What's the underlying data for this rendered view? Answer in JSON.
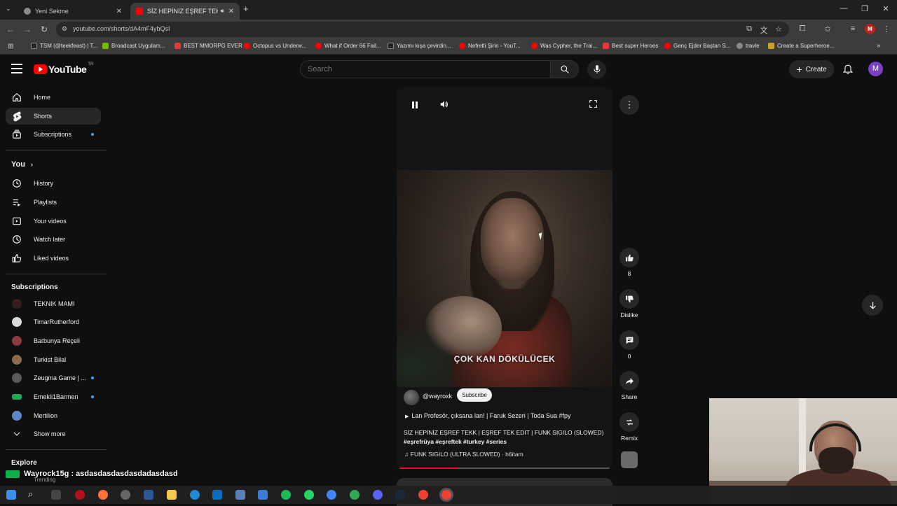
{
  "browser": {
    "tabs": [
      {
        "label": "Yeni Sekme",
        "active": false
      },
      {
        "label": "SİZ HEPİNİZ EŞREF TEKK | E",
        "active": true
      }
    ],
    "url": "youtube.com/shorts/dA4mF4ybQsI",
    "bookmarks": [
      "TSM (@teekfeast) | T...",
      "Broadcast Uygulam...",
      "BEST MMORPG EVER",
      "Octopus vs Underw...",
      "What if Order 66 Fail...",
      "Yazımı kışa çevirdin...",
      "Nefretli Şirin - YouT...",
      "Was Cypher, the Trai...",
      "Best super Heroes",
      "Genç Ejder Baştan S...",
      "travle",
      "Create a Superheroe..."
    ],
    "profile_initial": "M"
  },
  "header": {
    "logo_text": "YouTube",
    "country_code": "TR",
    "search_placeholder": "Search",
    "create_label": "Create",
    "avatar_initial": "M"
  },
  "sidebar": {
    "main": [
      {
        "label": "Home",
        "icon": "home-icon"
      },
      {
        "label": "Shorts",
        "icon": "shorts-icon",
        "active": true
      },
      {
        "label": "Subscriptions",
        "icon": "subscriptions-icon",
        "dot": true
      }
    ],
    "you_heading": "You",
    "you_items": [
      {
        "label": "History",
        "icon": "history-icon"
      },
      {
        "label": "Playlists",
        "icon": "playlists-icon"
      },
      {
        "label": "Your videos",
        "icon": "your-videos-icon"
      },
      {
        "label": "Watch later",
        "icon": "watch-later-icon"
      },
      {
        "label": "Liked videos",
        "icon": "liked-videos-icon"
      }
    ],
    "subscriptions_heading": "Subscriptions",
    "subscriptions": [
      {
        "label": "TEKNIK MAMI",
        "color": "#3a1c1c",
        "dot": false
      },
      {
        "label": "TimarRutherford",
        "color": "#d9d9d9",
        "dot": false
      },
      {
        "label": "Barbunya Reçeli",
        "color": "#8a3b3b",
        "dot": false
      },
      {
        "label": "Turkist Bilal",
        "color": "#8c6a4a",
        "dot": false
      },
      {
        "label": "Zeugma Game | ...",
        "color": "#5a5a5a",
        "dot": true
      },
      {
        "label": "Emekli1Barmen",
        "color": "#1faa59",
        "dot": true
      },
      {
        "label": "Mertilion",
        "color": "#5b87c5",
        "dot": false
      }
    ],
    "show_more": "Show more",
    "explore_heading": "Explore",
    "trending_label": "Trending"
  },
  "player": {
    "caption": "ÇOK KAN DÖKÜLÜCEK",
    "channel": "@wayroxk",
    "subscribe_label": "Subscribe",
    "song_line": "Lan Profesör, çıksana lan! | Faruk Sezeri | Toda Sua  #fpy",
    "description_line1": "SİZ HEPİNİZ EŞREF TEKK | EŞREF TEK EDIT |  FUNK SIGILO (SLOWED)",
    "description_line2": "#eşrefrüya #eşreftek #turkey #series",
    "music": "FUNK SIGILO (ULTRA SLOWED) · h6itam",
    "progress": 0.28
  },
  "actions": {
    "like_count": "8",
    "dislike_label": "Dislike",
    "comment_count": "0",
    "share_label": "Share",
    "remix_label": "Remix"
  },
  "chat": {
    "text": "Wayrock15g : asdasdasdasdasdadasdasd"
  },
  "colors": {
    "background": "#0f0f0f",
    "accent_red": "#ff0000",
    "progress": "#ff0033",
    "sub_dot": "#3ea6ff"
  }
}
